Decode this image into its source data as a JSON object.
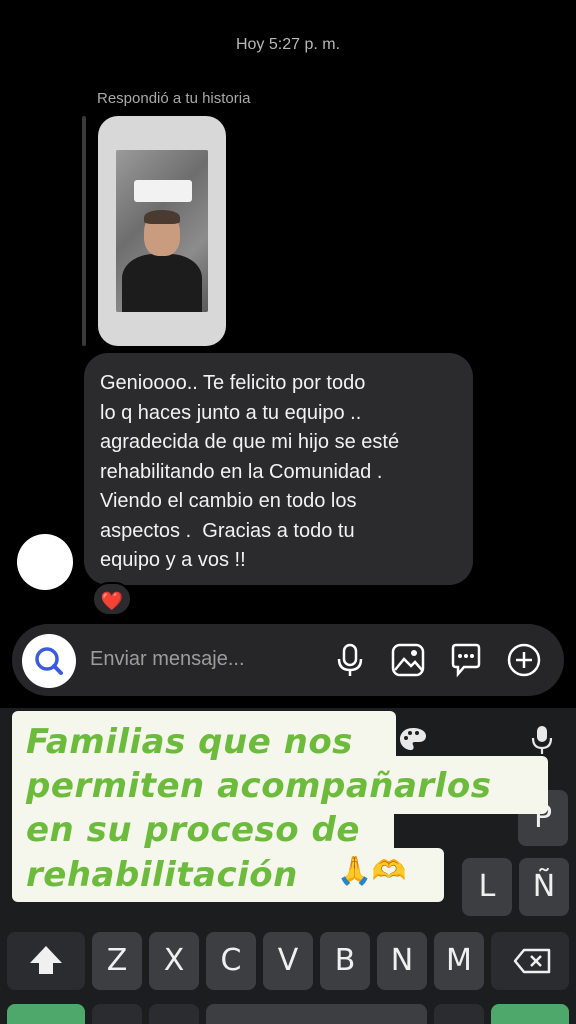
{
  "chat": {
    "timestamp": "Hoy 5:27 p. m.",
    "reply_context": "Respondió a tu historia",
    "message_lines": [
      "Genioooo.. Te felicito por todo",
      "lo q haces junto a tu equipo ..",
      "agradecida de que mi hijo se esté",
      "rehabilitando en la Comunidad .",
      "Viendo el cambio en todo los",
      "aspectos .  Gracias a todo tu",
      "equipo y a vos !!"
    ],
    "reaction": "❤️"
  },
  "composer": {
    "placeholder": "Enviar mensaje...",
    "icons": [
      "search-icon",
      "microphone-icon",
      "gallery-icon",
      "sticker-icon",
      "plus-icon"
    ]
  },
  "keyboard": {
    "row_bottom": [
      "Z",
      "X",
      "C",
      "V",
      "B",
      "N",
      "M"
    ],
    "visible_keys": {
      "l": "L",
      "ene": "Ñ",
      "p": "P"
    },
    "icons": [
      "palette-icon",
      "microphone-icon",
      "shift-icon",
      "backspace-icon"
    ]
  },
  "overlay": {
    "lines": [
      "Familias que nos",
      "permiten acompañarlos",
      "en su proceso de",
      "rehabilitación"
    ],
    "emojis": "🙏🫶",
    "color": "#6dbb3c"
  }
}
